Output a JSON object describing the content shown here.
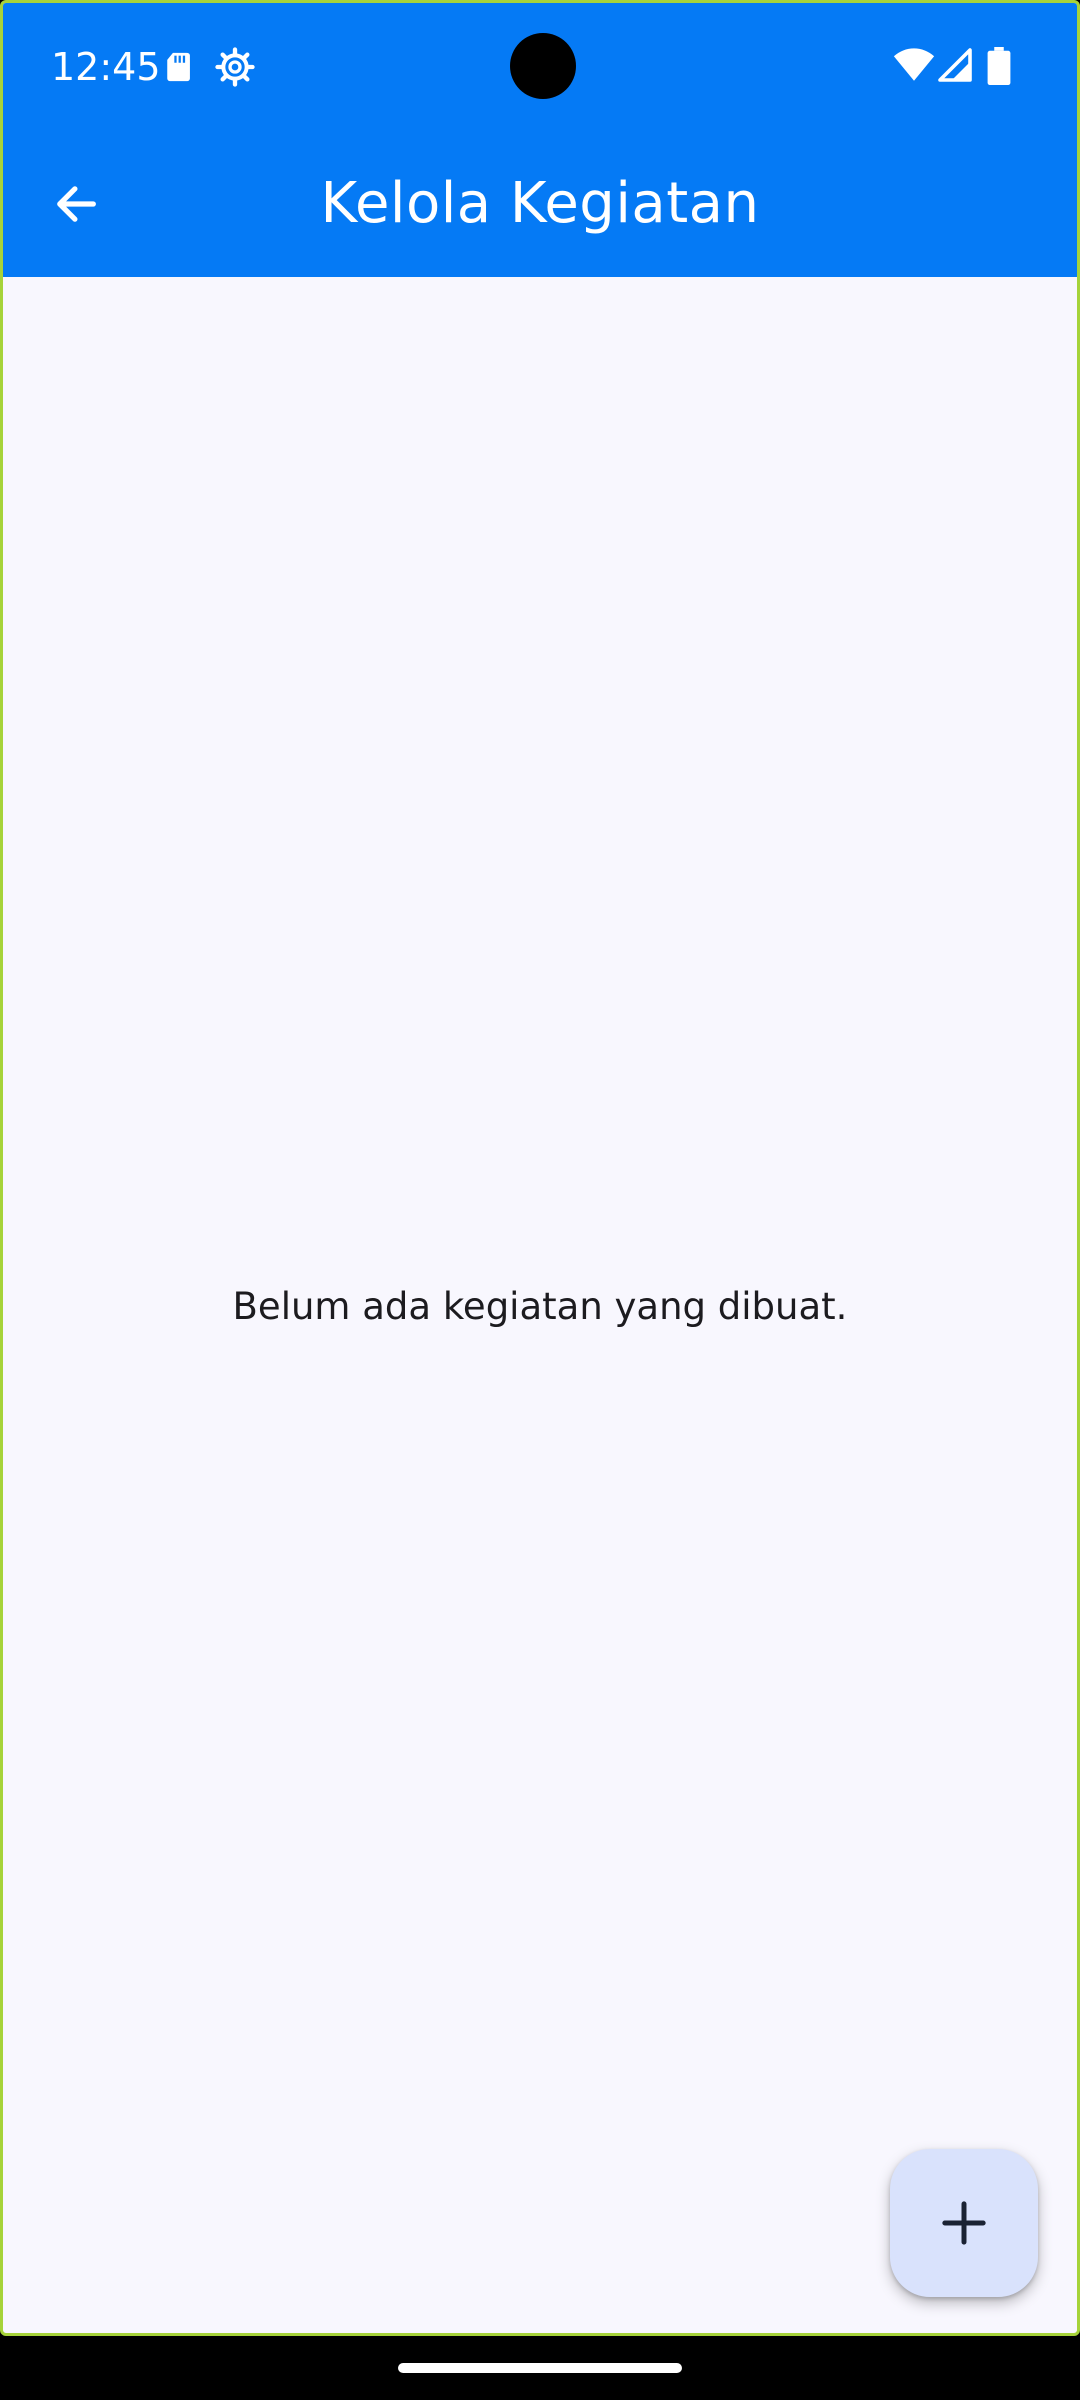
{
  "status_bar": {
    "time": "12:45",
    "icons": [
      "sd-card-icon",
      "gear-icon",
      "wifi-icon",
      "signal-icon",
      "battery-icon"
    ]
  },
  "app_bar": {
    "title": "Kelola Kegiatan",
    "back_icon": "arrow-left-icon"
  },
  "main": {
    "empty_message": "Belum ada kegiatan yang dibuat."
  },
  "fab": {
    "icon": "plus-icon"
  },
  "colors": {
    "primary": "#057af5",
    "background": "#f8f7fe",
    "fab_background": "#d9e2fc",
    "text": "#1c1b1f"
  }
}
